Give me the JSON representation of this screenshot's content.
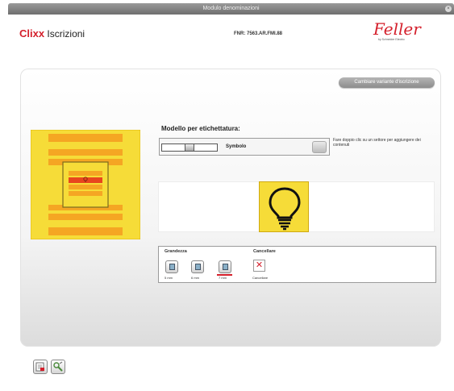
{
  "window": {
    "title": "Modulo denominazioni",
    "close_glyph": "×"
  },
  "header": {
    "brand_prefix": "Clixx",
    "brand_suffix": "Iscrizioni",
    "fnr": "FNR: 7563.AR.FMI.88",
    "logo_script": "Feller",
    "logo_sub": "by Schneider Electric"
  },
  "actions": {
    "change_variant_label": "Cambiare variante d'iscrizione"
  },
  "model": {
    "title": "Modello per etichettatura:",
    "selected": "Symbolo",
    "hint": "Fare doppio clic su un settore per aggiungere dei contenuti"
  },
  "tools": {
    "size_title": "Grandezza",
    "sizes": [
      "5 mm",
      "6 mm",
      "7 mm"
    ],
    "active_size_index": 2,
    "delete_title": "Cancellare",
    "delete_label": "Cancellare"
  },
  "colors": {
    "brand_red": "#d41f2b",
    "plate_yellow": "#f6dc38",
    "stripe_orange": "#f5a623",
    "stripe_red": "#e8461e"
  },
  "icons": {
    "preview": "light-bulb-icon",
    "delete": "red-x-icon",
    "footer": [
      "print-icon",
      "tools-icon"
    ]
  }
}
